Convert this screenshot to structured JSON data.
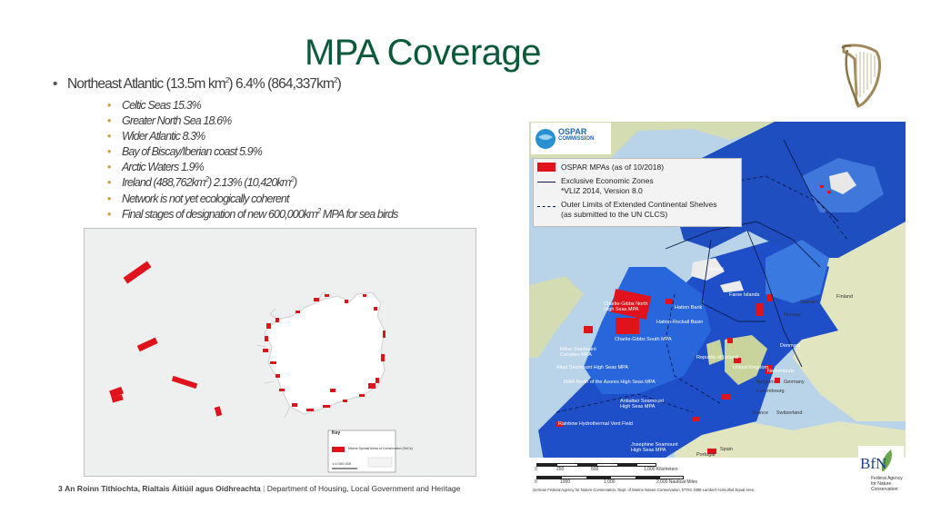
{
  "slide": {
    "title": "MPA Coverage",
    "main_bullet": {
      "pre": "Northeast Atlantic (13.5m km",
      "sup1": "2",
      "mid": ") 6.4% (864,337km",
      "sup2": "2",
      "post": ")"
    },
    "sub_bullets": {
      "celtic": "Celtic Seas 15.3%",
      "north_sea": "Greater North Sea 18.6%",
      "wider_atlantic": "Wider Atlantic 8.3%",
      "biscay": "Bay of Biscay/Iberian coast 5.9%",
      "arctic": "Arctic Waters 1.9%",
      "ireland": {
        "pre": "Ireland (488,762km",
        "sup1": "2",
        "mid": ") 2.13% (10,420km",
        "sup2": "2",
        "post": ")"
      },
      "network": "Network is not yet ecologically coherent",
      "final": {
        "pre": "Final stages of designation of new 600,000km",
        "sup": "2",
        "post": " MPA for sea birds"
      }
    }
  },
  "ireland_map": {
    "key_title": "Key",
    "key_item": "Marine Special Areas of Conservation (SACs)",
    "scale_text": "1:4,000,000",
    "fill_color": "#e0121c"
  },
  "ospar_map": {
    "logo_title": "OSPAR",
    "logo_sub": "COMMISSION",
    "legend": {
      "mpas": "OSPAR MPAs (as of 10/2018)",
      "eez1": "Exclusive Economic Zones",
      "eez2": "*VLIZ 2014, Version 8.0",
      "ecs1": "Outer Limits of Extended Continental Shelves",
      "ecs2": "(as submitted to the UN CLCS)"
    },
    "labels": {
      "charlie_north1": "Charlie-Gibbs North",
      "charlie_north2": "High Seas MPA",
      "hatton": "Hatton Bank",
      "hatton_rockall": "Hatton-Rockall Basin",
      "charlie_south": "Charlie-Gibbs South MPA",
      "milne1": "Milne Seamount",
      "milne2": "Complex MPA",
      "altair": "Altair Seamount High Seas MPA",
      "mar": "MAR North of the Azores High Seas MPA",
      "antialtair1": "Antialtair Seamount",
      "antialtair2": "High Seas MPA",
      "rainbow": "Rainbow Hydrothermal Vent Field",
      "josephine1": "Josephine Seamount",
      "josephine2": "High Seas MPA",
      "iceland": "Iceland",
      "faroe": "Faroe Islands",
      "sweden": "Sweden",
      "finland": "Finland",
      "norway": "Norway",
      "denmark": "Denmark",
      "ireland": "Republic of Ireland",
      "uk": "United Kingdom",
      "netherlands": "Netherlands",
      "belgium": "Belgium",
      "germany": "Germany",
      "luxembourg": "Luxembourg",
      "france": "France",
      "switzerland": "Switzerland",
      "spain": "Spain",
      "portugal": "Portugal"
    },
    "scale_km": [
      "0",
      "250",
      "500",
      "1,000 Kilometers"
    ],
    "scale_nm": [
      "0",
      "1000",
      "1,000",
      "2,000 Nautical Miles"
    ],
    "credit": "German Federal Agency for Nature Conservation, Dept. of Marine Nature Conservation, ETRS 1989 Lambert Azimuthal Equal Area"
  },
  "bfn_logo": {
    "mark": "BfN",
    "line1": "Federal Agency",
    "line2": "for Nature",
    "line3": "Conservation"
  },
  "footer": {
    "number": "3",
    "irish": "An Roinn Tithíochta, Rialtais Áitiúil agus Oidhreachta",
    "separator": "|",
    "english": "Department of Housing, Local Government and Heritage"
  }
}
